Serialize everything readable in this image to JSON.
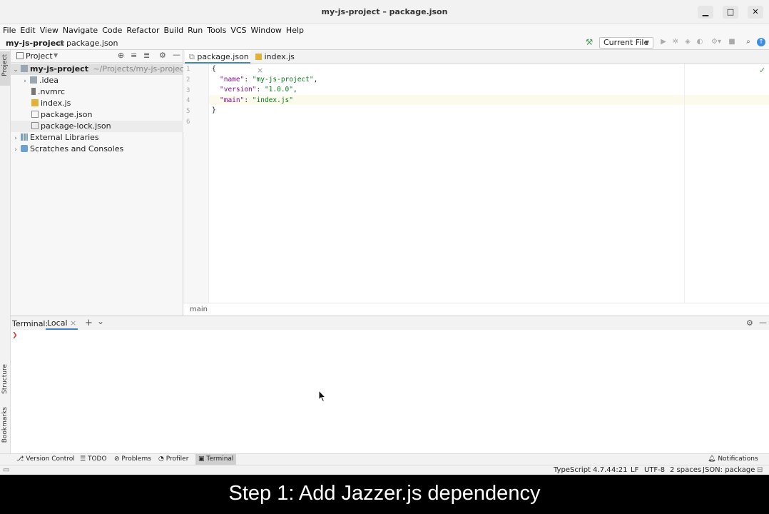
{
  "window": {
    "title": "my-js-project – package.json",
    "minimize": "▁",
    "maximize": "□",
    "close": "✕"
  },
  "menu": [
    "File",
    "Edit",
    "View",
    "Navigate",
    "Code",
    "Refactor",
    "Build",
    "Run",
    "Tools",
    "VCS",
    "Window",
    "Help"
  ],
  "navbar": {
    "project": "my-js-project",
    "file": "package.json",
    "run_config": "Current File"
  },
  "sidebar": {
    "project_tab": "Project",
    "structure_tab": "Structure",
    "bookmarks_tab": "Bookmarks"
  },
  "project_panel": {
    "title": "Project",
    "root": {
      "name": "my-js-project",
      "path": "~/Projects/my-js-project"
    },
    "items": [
      {
        "label": ".idea"
      },
      {
        "label": ".nvmrc"
      },
      {
        "label": "index.js"
      },
      {
        "label": "package.json"
      },
      {
        "label": "package-lock.json"
      }
    ],
    "external": "External Libraries",
    "scratches": "Scratches and Consoles"
  },
  "editor": {
    "tabs": [
      {
        "label": "package.json",
        "close": "×"
      },
      {
        "label": "index.js",
        "close": "×"
      }
    ],
    "line_numbers": [
      "1",
      "2",
      "3",
      "4",
      "5",
      "6"
    ],
    "code": {
      "l1": "{",
      "name_key": "\"name\"",
      "name_val": "\"my-js-project\"",
      "version_key": "\"version\"",
      "version_val": "\"1.0.0\"",
      "main_key": "\"main\"",
      "main_val": "\"index.js\"",
      "l5": "}"
    },
    "breadcrumb": "main"
  },
  "terminal": {
    "label": "Terminal:",
    "tab": "Local",
    "tab_close": "×",
    "add": "+",
    "more": "⌄",
    "prompt": "❯"
  },
  "bottom_tools": [
    {
      "label": "Version Control",
      "icon": "⎇"
    },
    {
      "label": "TODO",
      "icon": "☰"
    },
    {
      "label": "Problems",
      "icon": "⊘"
    },
    {
      "label": "Profiler",
      "icon": "◔"
    },
    {
      "label": "Terminal",
      "icon": "▣"
    }
  ],
  "notifications": "Notifications",
  "status": {
    "typescript": "TypeScript 4.7.4",
    "position": "4:21",
    "line_sep": "LF",
    "encoding": "UTF-8",
    "indent": "2 spaces",
    "schema": "JSON: package"
  },
  "caption": "Step 1: Add Jazzer.js dependency",
  "colors": {
    "accent": "#4083c9",
    "json_key": "#871094",
    "json_string": "#067d17",
    "build_icon": "#499c54"
  }
}
